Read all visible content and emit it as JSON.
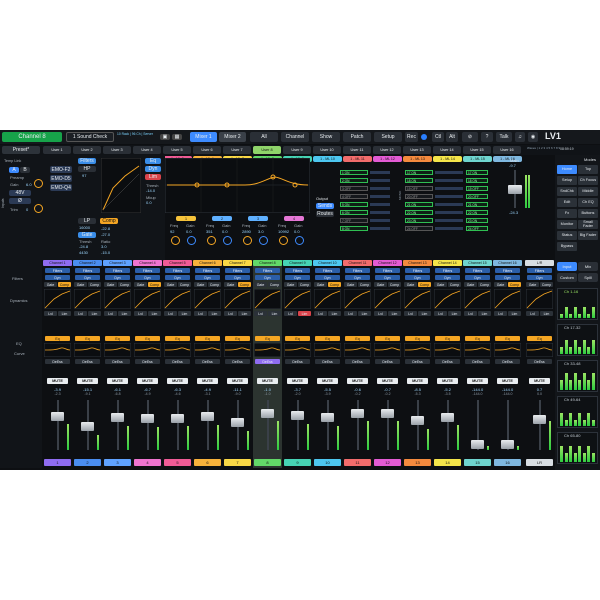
{
  "topbar": {
    "channel": "Channel 8",
    "scene": "1 Sound Check",
    "mini_info": "10 Rack | 96 Ch | Server",
    "mixer1": "Mixer 1",
    "mixer2": "Mixer 2",
    "tabs": [
      "All",
      "Channel",
      "Show",
      "Patch",
      "Setup"
    ],
    "rec": "Rec",
    "ctl": "Ctl",
    "alt": "Alt",
    "talk": "Talk",
    "logo": "LV1",
    "session": "Waves | 1 2 3 4 5 6 7 8 9",
    "clock": "08:59:19"
  },
  "user_layers": [
    "User 1",
    "User 2",
    "User 3",
    "User 4",
    "User 5",
    "User 6",
    "User 7",
    "User 8",
    "User 9",
    "User 10",
    "User 11",
    "User 12",
    "User 13",
    "User 14",
    "User 15",
    "User 16"
  ],
  "ml_groups": [
    "1 - ML 1",
    "1 - ML 2",
    "1 - ML 3",
    "1 - ML 4",
    "1 - ML 5",
    "1 - ML 6",
    "1 - ML 7",
    "1 - ML 8",
    "1 - ML 9",
    "1 - ML 10",
    "1 - ML 11",
    "1 - ML 12",
    "1 - ML 13",
    "1 - ML 14",
    "1 - ML 15",
    "1 - ML 16"
  ],
  "channel_view": {
    "preset": "Preset*",
    "temp_link": "Temp Link",
    "preamp": "Preamp",
    "gain_label": "Gain",
    "gain_val": "6.0",
    "phantom": "48V",
    "trim_label": "Trim",
    "trim_val": "0",
    "inputs": "Inputs",
    "plugins": [
      "EMO-F2",
      "EMO-D5",
      "EMO-Q4"
    ],
    "filters": "Filters",
    "hp": "HP",
    "hp_val": "97",
    "lp": "LP",
    "lp_val": "16000",
    "gate": "Gate",
    "thresh": "Thresh",
    "thresh_val": "-24.8",
    "gate_vals": [
      "4430",
      "-15.0"
    ],
    "comp": "Comp",
    "comp_vals": [
      "-22.8",
      "-27.0"
    ],
    "ratio": "Ratio",
    "ratio_val": "3.0",
    "dyn_side": [
      "Eq",
      "Dyn",
      "Lim"
    ],
    "lim_thresh": "Thresh",
    "lim_thresh_val": "-14.0",
    "mkup": "Mkup",
    "mkup_val": "0.0",
    "eq_bands": [
      {
        "n": "1",
        "freq": "92",
        "gain": "0.0"
      },
      {
        "n": "2",
        "freq": "351",
        "gain": "0.0"
      },
      {
        "n": "3",
        "freq": "2890",
        "gain": "3.0"
      },
      {
        "n": "4",
        "freq": "10992",
        "gain": "0.0"
      }
    ],
    "freq_l": "Freq",
    "gain_l": "Gain",
    "output": "Output",
    "sends": "Sends",
    "routes": "Routes",
    "main": "Main",
    "master": "-9.7",
    "level": "-24.3"
  },
  "sends_left": [
    "1 ON",
    "2 ON",
    "3 OFF",
    "4 OFF",
    "5 ON",
    "6 ON",
    "7 OFF",
    "8 ON"
  ],
  "sends_right": [
    "17 ON",
    "18 ON",
    "19 OFF",
    "20 OFF",
    "21 ON",
    "22 ON",
    "23 ON",
    "24 OFF"
  ],
  "strips": [
    {
      "name": "Channel 1",
      "color": "#8f6cf0",
      "val": "-3.9",
      "sub": "-2.3",
      "num": "1"
    },
    {
      "name": "Channel 2",
      "color": "#4a8df0",
      "val": "-15.1",
      "sub": "-9.1",
      "num": "2"
    },
    {
      "name": "Channel 3",
      "color": "#5fa2ff",
      "val": "-6.1",
      "sub": "-6.8",
      "num": "3"
    },
    {
      "name": "Channel 4",
      "color": "#ef74d0",
      "val": "-6.7",
      "sub": "-4.9",
      "num": "4"
    },
    {
      "name": "Channel 5",
      "color": "#f05b96",
      "val": "-6.3",
      "sub": "-4.6",
      "num": "5"
    },
    {
      "name": "Channel 6",
      "color": "#f7b23b",
      "val": "-4.9",
      "sub": "-3.1",
      "num": "6"
    },
    {
      "name": "Channel 7",
      "color": "#f9d846",
      "val": "-11.1",
      "sub": "-9.0",
      "num": "7"
    },
    {
      "name": "Channel 8",
      "color": "#62d868",
      "val": "-1.0",
      "sub": "-1.0",
      "num": "8"
    },
    {
      "name": "Channel 9",
      "color": "#46d3b4",
      "val": "-3.7",
      "sub": "-2.0",
      "num": "9"
    },
    {
      "name": "Channel 10",
      "color": "#4dc7f0",
      "val": "-5.5",
      "sub": "-3.9",
      "num": "10"
    },
    {
      "name": "Channel 11",
      "color": "#f26c6c",
      "val": "-0.6",
      "sub": "-0.2",
      "num": "11"
    },
    {
      "name": "Channel 12",
      "color": "#e35bd4",
      "val": "-0.7",
      "sub": "-0.2",
      "num": "12"
    },
    {
      "name": "Channel 13",
      "color": "#f48a3e",
      "val": "-8.5",
      "sub": "-5.3",
      "num": "13"
    },
    {
      "name": "Channel 14",
      "color": "#f4e54a",
      "val": "-5.2",
      "sub": "-3.5",
      "num": "14"
    },
    {
      "name": "Channel 15",
      "color": "#6fd5cf",
      "val": "-144.0",
      "sub": "-144.0",
      "num": "15"
    },
    {
      "name": "Channel 16",
      "color": "#7fb8e0",
      "val": "-144.0",
      "sub": "-144.0",
      "num": "16"
    }
  ],
  "strip_labels": {
    "filters": "Filters",
    "dyn": "Dyn",
    "gate": "Gate",
    "comp": "Comp",
    "eq": "Eq",
    "deess": "DeEss",
    "mute": "MUTE",
    "lvl": "Lvl",
    "lim": "Lim"
  },
  "lr_strip": {
    "name": "L/R",
    "val": "0.7",
    "sub": "0.0",
    "num": "LR"
  },
  "section_labels": [
    "Filters",
    "Dynamics",
    "EQ",
    "Curve"
  ],
  "right_panel": {
    "modes": "Modes",
    "buttons": [
      "Home",
      "Top",
      "Setup",
      "Ch Focus",
      "SndChk",
      "Middle",
      "Edit",
      "Ch EQ",
      "Fx",
      "Buttons",
      "Monitor",
      "Small Fader",
      "Status",
      "Big Fader",
      "Bypass"
    ],
    "input": "Input",
    "mix": "Mix",
    "custom": "Custom",
    "spill": "Spill",
    "banks": [
      "Ch 1-16",
      "Ch 17-32",
      "Ch 33-48",
      "Ch 49-64",
      "Ch 65-80"
    ]
  },
  "colors": {
    "accent": "#f5a623",
    "selected": "#8fd46a",
    "green": "#2ecc40",
    "blue": "#3d8bff"
  }
}
